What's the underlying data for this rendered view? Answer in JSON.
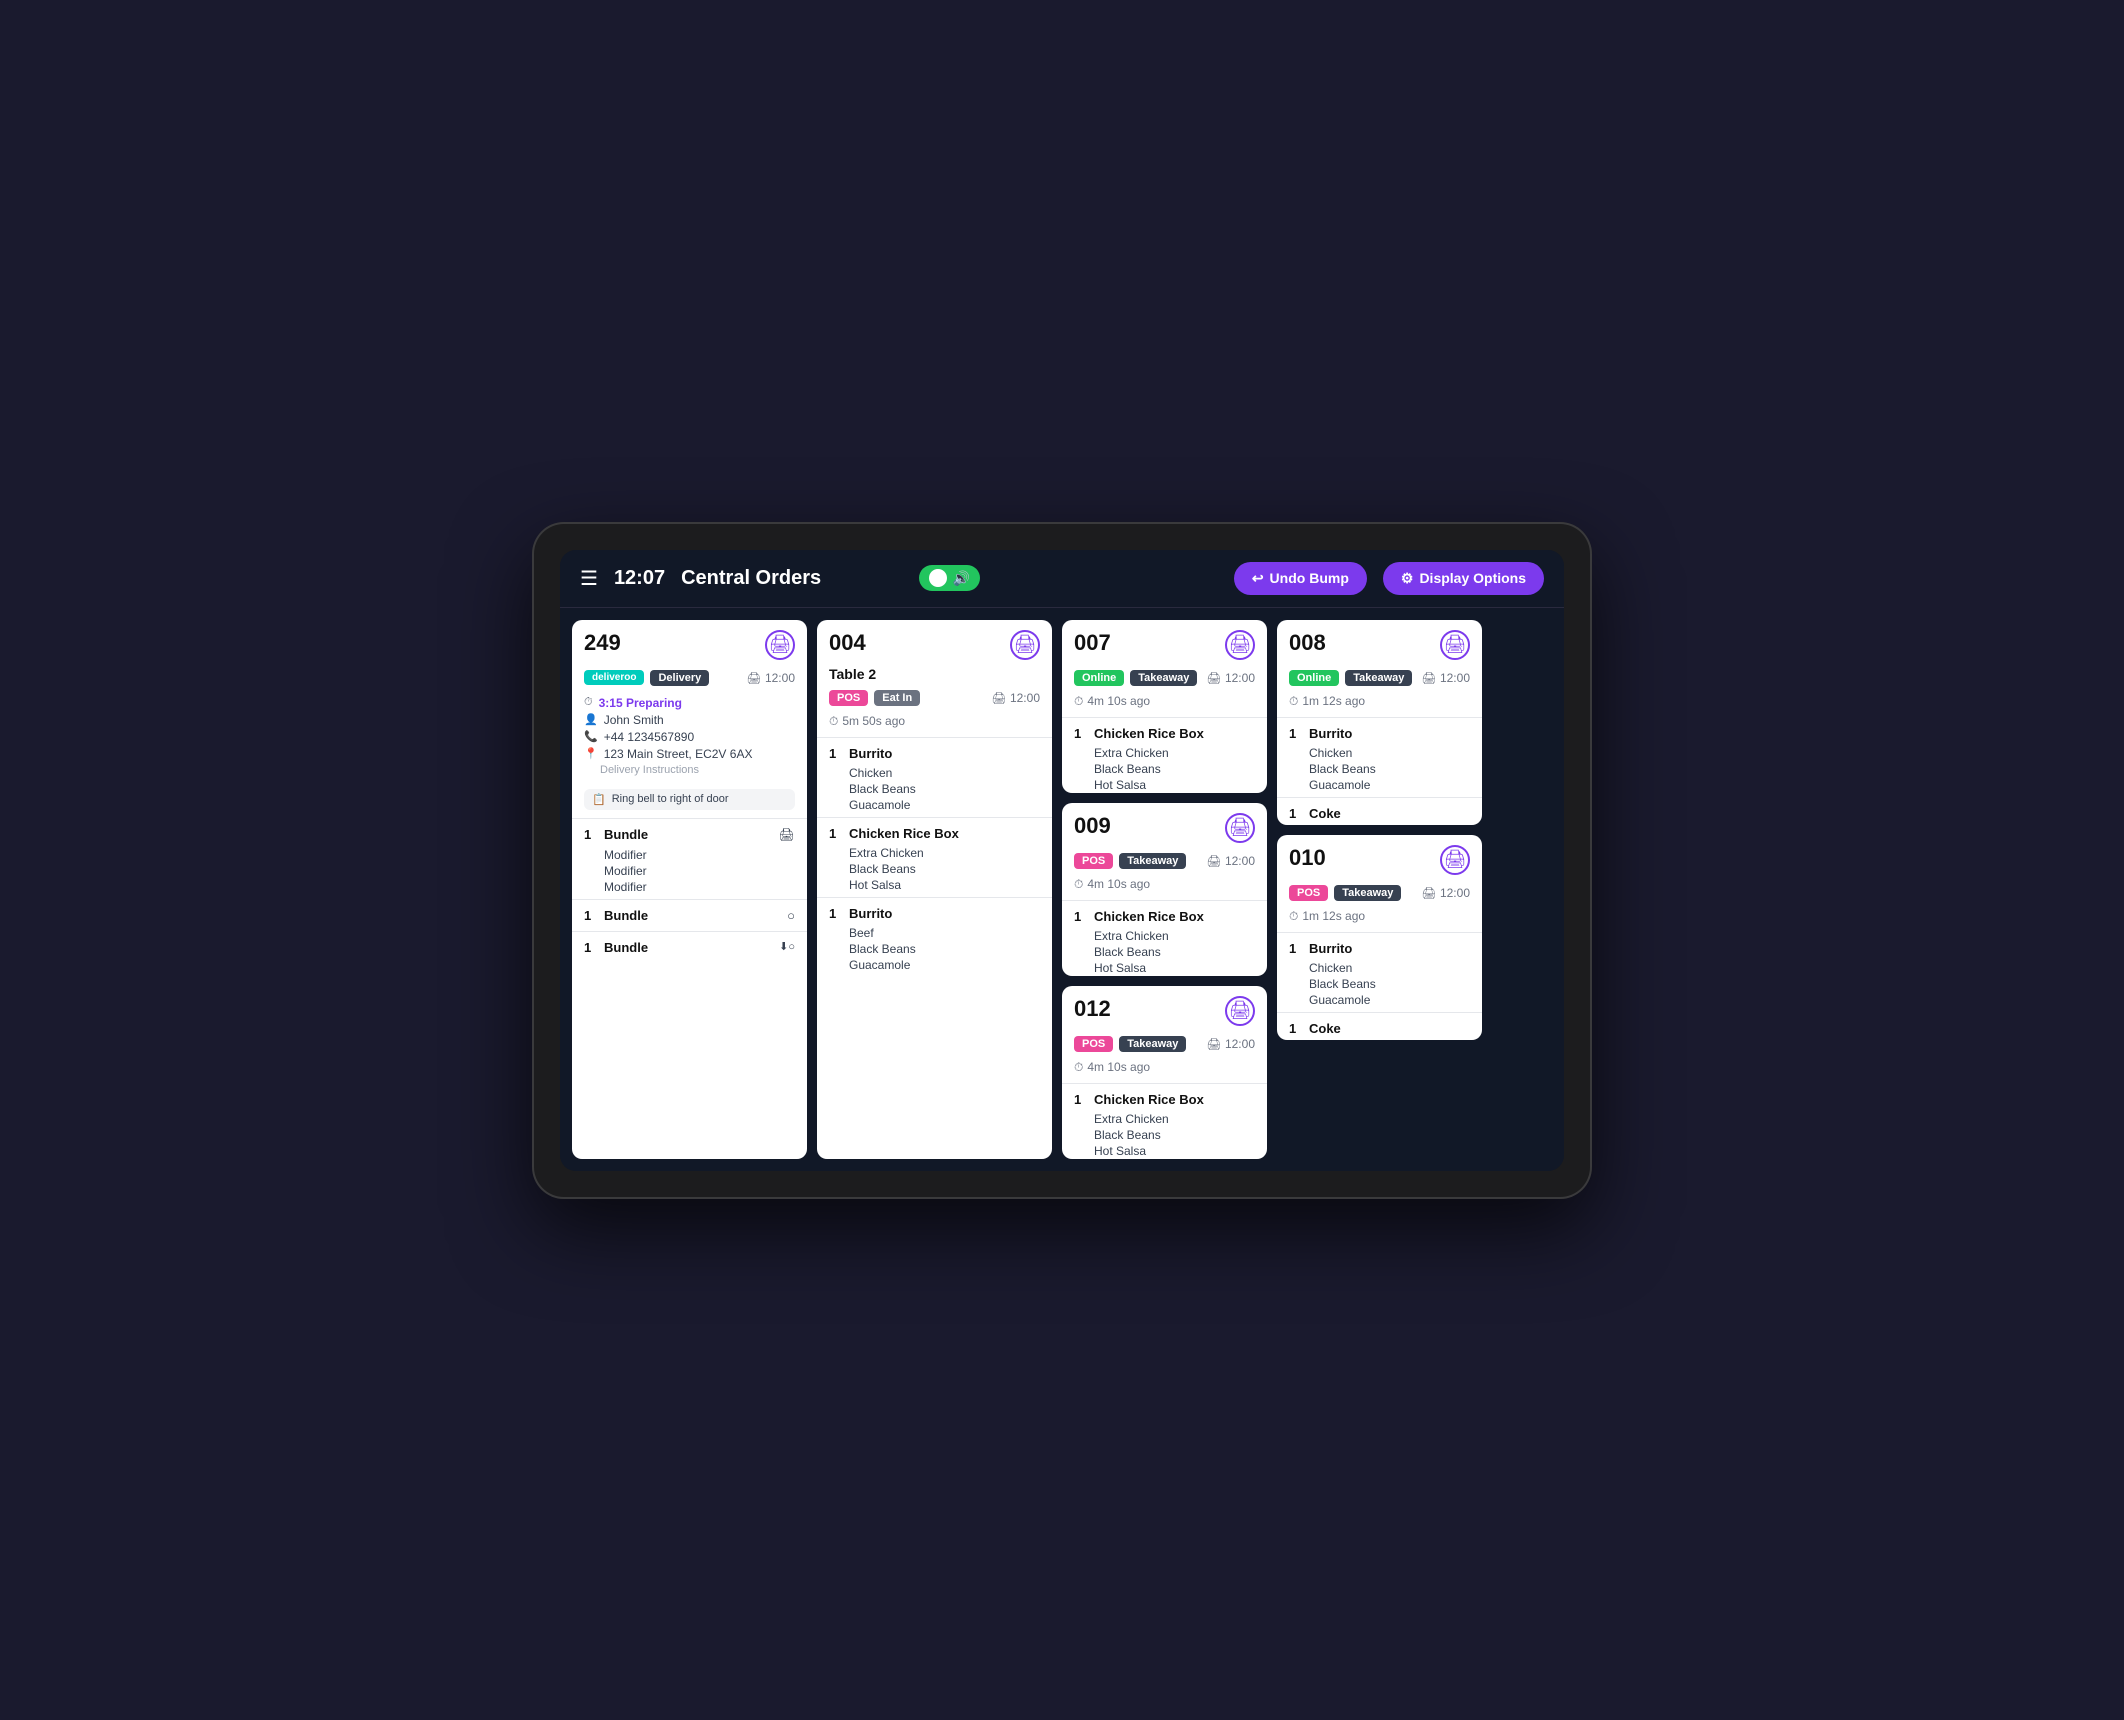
{
  "header": {
    "time": "12:07",
    "title": "Central Orders",
    "undo_label": "Undo Bump",
    "display_options_label": "Display Options"
  },
  "orders": [
    {
      "id": "order-249",
      "number": "249",
      "tags": [
        "deliveroo",
        "Delivery"
      ],
      "clock_time": "12:00",
      "status": "3:15 Preparing",
      "customer_name": "John Smith",
      "customer_phone": "+44 1234567890",
      "customer_address": "123 Main Street, EC2V 6AX",
      "delivery_instructions_label": "Delivery Instructions",
      "delivery_note": "Ring bell to right of door",
      "items": [
        {
          "qty": "1",
          "name": "Bundle",
          "modifiers": [
            "Modifier",
            "Modifier",
            "Modifier"
          ],
          "icon": "🖨"
        },
        {
          "qty": "1",
          "name": "Bundle",
          "modifiers": [],
          "icon": "○"
        },
        {
          "qty": "1",
          "name": "Bundle",
          "modifiers": [],
          "icon": "⬇○"
        }
      ]
    },
    {
      "id": "order-004",
      "number": "004",
      "table": "Table 2",
      "tags": [
        "POS",
        "Eat In"
      ],
      "clock_time": "12:00",
      "time_ago": "5m 50s ago",
      "items": [
        {
          "qty": "1",
          "name": "Burrito",
          "modifiers": [
            "Chicken",
            "Black Beans",
            "Guacamole"
          ]
        },
        {
          "qty": "1",
          "name": "Chicken Rice Box",
          "modifiers": [
            "Extra Chicken",
            "Black Beans",
            "Hot Salsa"
          ]
        },
        {
          "qty": "1",
          "name": "Burrito",
          "modifiers": [
            "Beef",
            "Black Beans",
            "Guacamole"
          ]
        }
      ]
    },
    {
      "id": "order-007",
      "number": "007",
      "tags": [
        "Online",
        "Takeaway"
      ],
      "clock_time": "12:00",
      "time_ago": "4m 10s ago",
      "items": [
        {
          "qty": "1",
          "name": "Chicken Rice Box",
          "modifiers": [
            "Extra Chicken",
            "Black Beans",
            "Hot Salsa"
          ]
        }
      ]
    },
    {
      "id": "order-009",
      "number": "009",
      "tags": [
        "POS",
        "Takeaway"
      ],
      "clock_time": "12:00",
      "time_ago": "4m 10s ago",
      "items": [
        {
          "qty": "1",
          "name": "Chicken Rice Box",
          "modifiers": [
            "Extra Chicken",
            "Black Beans",
            "Hot Salsa"
          ]
        }
      ]
    },
    {
      "id": "order-012",
      "number": "012",
      "tags": [
        "POS",
        "Takeaway"
      ],
      "clock_time": "12:00",
      "time_ago": "4m 10s ago",
      "items": [
        {
          "qty": "1",
          "name": "Chicken Rice Box",
          "modifiers": [
            "Extra Chicken",
            "Black Beans",
            "Hot Salsa"
          ]
        }
      ]
    },
    {
      "id": "order-008",
      "number": "008",
      "tags": [
        "Online",
        "Takeaway"
      ],
      "clock_time": "12:00",
      "time_ago": "1m 12s ago",
      "items": [
        {
          "qty": "1",
          "name": "Burrito",
          "modifiers": [
            "Chicken",
            "Black Beans",
            "Guacamole"
          ]
        },
        {
          "qty": "1",
          "name": "Coke",
          "modifiers": []
        }
      ]
    },
    {
      "id": "order-010",
      "number": "010",
      "tags": [
        "POS",
        "Takeaway"
      ],
      "clock_time": "12:00",
      "time_ago": "1m 12s ago",
      "items": [
        {
          "qty": "1",
          "name": "Burrito",
          "modifiers": [
            "Chicken",
            "Black Beans",
            "Guacamole"
          ]
        },
        {
          "qty": "1",
          "name": "Coke",
          "modifiers": []
        }
      ]
    }
  ]
}
